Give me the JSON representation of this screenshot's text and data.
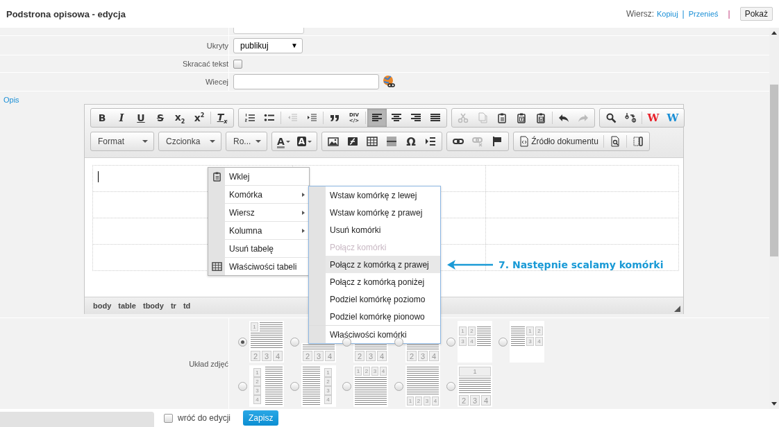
{
  "header": {
    "title": "Podstrona opisowa - edycja",
    "row_label": "Wiersz:",
    "links": [
      "Kopiuj",
      "Przenieś"
    ],
    "separators": [
      "|",
      "|"
    ],
    "show_button": "Pokaż"
  },
  "form": {
    "rows": [
      {
        "kind": "cutoff"
      },
      {
        "kind": "select",
        "label": "Ukryty",
        "value": "publikuj",
        "arrow": "▼"
      },
      {
        "kind": "checkbox",
        "label": "Skracać tekst",
        "checked": false
      },
      {
        "kind": "text",
        "label": "Wiecej"
      }
    ]
  },
  "description": {
    "label": "Opis",
    "toolbar": [
      [
        {
          "items": [
            {
              "kind": "bold",
              "text": "B",
              "disabled": false,
              "on": false
            },
            {
              "kind": "italic",
              "text": "I",
              "disabled": false,
              "on": false
            },
            {
              "kind": "underline",
              "text": "U",
              "disabled": false,
              "on": false
            },
            {
              "kind": "strike",
              "text": "S",
              "disabled": false,
              "on": false
            },
            {
              "kind": "subscript",
              "text": "x$_{2}$",
              "disabled": false,
              "on": false
            },
            {
              "kind": "superscript",
              "text": "x$^{2}$",
              "disabled": false,
              "on": false
            },
            {
              "kind": "sep"
            },
            {
              "kind": "clear-format",
              "text": "T$_{x}$",
              "disabled": false,
              "on": false
            }
          ]
        },
        {
          "items": [
            {
              "kind": "numbered-list",
              "disabled": false,
              "on": false
            },
            {
              "kind": "bulleted-list",
              "disabled": false,
              "on": false
            },
            {
              "kind": "sep"
            },
            {
              "kind": "outdent",
              "disabled": true,
              "on": false
            },
            {
              "kind": "indent",
              "disabled": false,
              "on": false
            },
            {
              "kind": "sep"
            },
            {
              "kind": "blockquote",
              "disabled": false,
              "on": false
            },
            {
              "kind": "div",
              "text": "DIV\n</>",
              "disabled": false,
              "on": false
            },
            {
              "kind": "sep"
            },
            {
              "kind": "align-left",
              "disabled": false,
              "on": true
            },
            {
              "kind": "align-center",
              "disabled": false,
              "on": false
            },
            {
              "kind": "align-right",
              "disabled": false,
              "on": false
            },
            {
              "kind": "justify",
              "disabled": false,
              "on": false
            }
          ]
        },
        {
          "items": [
            {
              "kind": "cut",
              "disabled": true,
              "on": false
            },
            {
              "kind": "copy",
              "disabled": true,
              "on": false
            },
            {
              "kind": "paste",
              "disabled": false,
              "on": false
            },
            {
              "kind": "paste-text",
              "disabled": false,
              "on": false
            },
            {
              "kind": "paste-word",
              "disabled": false,
              "on": false
            },
            {
              "kind": "sep"
            },
            {
              "kind": "undo",
              "disabled": false,
              "on": false
            },
            {
              "kind": "redo",
              "disabled": true,
              "on": false
            }
          ]
        },
        {
          "items": [
            {
              "kind": "find",
              "disabled": false,
              "on": false
            },
            {
              "kind": "replace",
              "disabled": false,
              "on": false
            },
            {
              "kind": "sep"
            },
            {
              "kind": "spellcheck",
              "text": "W",
              "color": "#e8202a",
              "disabled": false
            },
            {
              "kind": "spellcheck",
              "text": "W",
              "color": "#1a8fd6",
              "disabled": false
            }
          ]
        }
      ],
      [
        {
          "combo": "Format"
        },
        {
          "combo": "Czcionka"
        },
        {
          "combo": "Ro..."
        },
        {
          "items": [
            {
              "kind": "text-color",
              "text": "A",
              "disabled": false,
              "on": false
            },
            {
              "kind": "background-color",
              "text": "A",
              "disabled": false,
              "on": false
            }
          ]
        },
        {
          "items": [
            {
              "kind": "image",
              "disabled": false,
              "on": false
            },
            {
              "kind": "flash",
              "disabled": false,
              "on": false
            },
            {
              "kind": "table",
              "disabled": false,
              "on": false
            },
            {
              "kind": "horizontal-line",
              "disabled": false,
              "on": false
            },
            {
              "kind": "special-char",
              "text": "Ω",
              "disabled": false,
              "on": false
            },
            {
              "kind": "page-break",
              "disabled": false,
              "on": false
            }
          ]
        },
        {
          "items": [
            {
              "kind": "link",
              "disabled": false,
              "on": false
            },
            {
              "kind": "unlink",
              "disabled": true,
              "on": false
            },
            {
              "kind": "anchor",
              "disabled": false,
              "on": false
            }
          ]
        },
        {
          "items": [
            {
              "kind": "source",
              "text": "Źródło dokumentu",
              "disabled": false,
              "on": false
            },
            {
              "kind": "sep"
            },
            {
              "kind": "preview",
              "disabled": false,
              "on": false
            },
            {
              "kind": "sep"
            },
            {
              "kind": "templates",
              "disabled": false,
              "on": false
            }
          ]
        }
      ]
    ],
    "path": [
      "body",
      "table",
      "tbody",
      "tr",
      "td"
    ]
  },
  "context_menu": {
    "items": [
      {
        "kind": "paste",
        "label": "Wklej"
      },
      {
        "kind": "submenu",
        "label": "Komórka"
      },
      {
        "kind": "submenu",
        "label": "Wiersz"
      },
      {
        "kind": "submenu",
        "label": "Kolumna"
      },
      {
        "kind": "plain",
        "label": "Usuń tabelę"
      },
      {
        "kind": "table",
        "label": "Właściwości tabeli"
      }
    ]
  },
  "submenu": {
    "items": [
      {
        "label": "Wstaw komórkę z lewej",
        "disabled": false,
        "selected": false
      },
      {
        "label": "Wstaw komórkę z prawej",
        "disabled": false,
        "selected": false
      },
      {
        "label": "Usuń komórki",
        "disabled": false,
        "selected": false
      },
      {
        "label": "Połącz komórki",
        "disabled": true,
        "selected": false
      },
      {
        "label": "Połącz z komórką z prawej",
        "disabled": false,
        "selected": true
      },
      {
        "label": "Połącz z komórką poniżej",
        "disabled": false,
        "selected": false
      },
      {
        "label": "Podziel komórkę poziomo",
        "disabled": false,
        "selected": false
      },
      {
        "label": "Podziel komórkę pionowo",
        "disabled": false,
        "selected": false
      },
      {
        "label": "Właściwości komórki",
        "disabled": false,
        "selected": false
      }
    ]
  },
  "annotation": {
    "text": "7. Następnie scalamy komórki"
  },
  "photo_layout": {
    "label": "Układ zdjęć",
    "options": [
      {
        "kind": "feature-left",
        "digits": [
          "1",
          "2",
          "3",
          "4"
        ],
        "selected": true
      },
      {
        "kind": "covered",
        "digits": [
          "2",
          "3",
          "4"
        ],
        "selected": false
      },
      {
        "kind": "covered",
        "digits": [
          "2",
          "3",
          "4"
        ],
        "selected": false
      },
      {
        "kind": "covered",
        "digits": [
          "2",
          "3",
          "4"
        ],
        "selected": false
      },
      {
        "kind": "grid-left",
        "digits": [
          "1",
          "2",
          "3",
          "4"
        ],
        "selected": false
      },
      {
        "kind": "grid-right",
        "digits": [
          "1",
          "2",
          "3",
          "4"
        ],
        "selected": false
      },
      {
        "kind": "column-left",
        "digits": [
          "1",
          "2",
          "3",
          "4"
        ],
        "selected": false
      },
      {
        "kind": "column-right",
        "digits": [
          "1",
          "2",
          "3",
          "4"
        ],
        "selected": false
      },
      {
        "kind": "top-row",
        "digits": [
          "1",
          "2",
          "3",
          "4"
        ],
        "selected": false
      },
      {
        "kind": "lines-bottom",
        "digits": [
          "1",
          "2",
          "3",
          "4"
        ],
        "selected": false
      },
      {
        "kind": "banner",
        "digits": [
          "1",
          "2",
          "3",
          "4"
        ],
        "selected": false
      }
    ]
  },
  "footer": {
    "return_label": "wróć do edycji",
    "return_checked": false,
    "save_button": "Zapisz"
  }
}
